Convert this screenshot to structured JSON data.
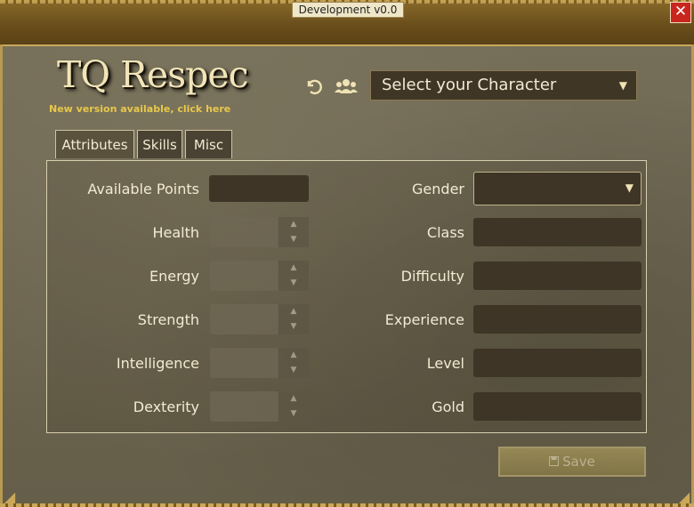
{
  "window": {
    "title": "Development v0.0",
    "close_label": "✕"
  },
  "app": {
    "logo_text": "TQ Respec",
    "update_link": "New version available, click here"
  },
  "toolbar": {
    "undo_icon": "undo-icon",
    "users_icon": "users-icon",
    "character_select": {
      "value": "Select your Character",
      "arrow": "▼"
    }
  },
  "tabs": [
    {
      "label": "Attributes",
      "active": true
    },
    {
      "label": "Skills",
      "active": false
    },
    {
      "label": "Misc",
      "active": false
    }
  ],
  "attributes": {
    "available_points_label": "Available Points",
    "fields": [
      {
        "label": "Health"
      },
      {
        "label": "Energy"
      },
      {
        "label": "Strength"
      },
      {
        "label": "Intelligence"
      },
      {
        "label": "Dexterity"
      }
    ],
    "stepper_up": "▲",
    "stepper_down": "▼"
  },
  "info": {
    "gender_label": "Gender",
    "gender_arrow": "▼",
    "fields": [
      {
        "label": "Class"
      },
      {
        "label": "Difficulty"
      },
      {
        "label": "Experience"
      },
      {
        "label": "Level"
      },
      {
        "label": "Gold"
      }
    ]
  },
  "actions": {
    "save_label": "Save",
    "save_icon": "save-icon"
  },
  "colors": {
    "link": "#e8c84a",
    "field_bg": "#3e3526",
    "text": "#f3ead2"
  }
}
